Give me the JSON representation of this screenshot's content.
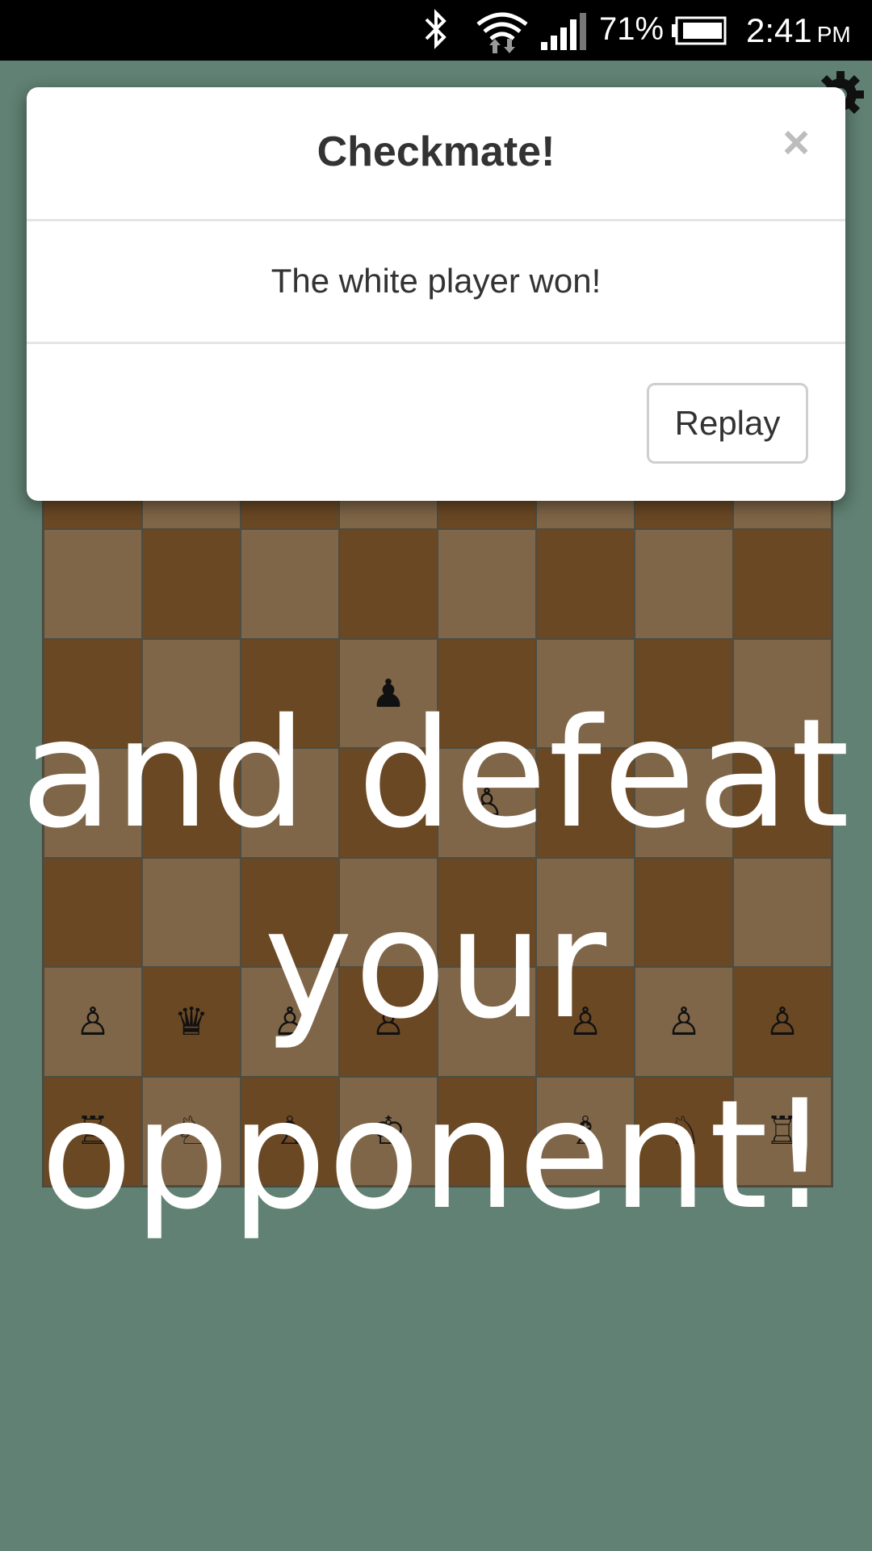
{
  "status_bar": {
    "battery_percent": "71%",
    "time": "2:41",
    "ampm": "PM",
    "icons": [
      "bluetooth-icon",
      "wifi-icon",
      "signal-icon",
      "battery-icon"
    ]
  },
  "settings": {
    "icon": "gear-icon"
  },
  "dialog": {
    "title": "Checkmate!",
    "close_label": "×",
    "message": "The white player won!",
    "replay_label": "Replay"
  },
  "board": {
    "dark_color": "#6b4824",
    "light_color": "#806648",
    "rows": [
      [
        "",
        "",
        "",
        "",
        "",
        "",
        "",
        ""
      ],
      [
        "♟",
        "♟",
        "♟",
        "",
        "♟",
        "♟",
        "♟",
        "♟"
      ],
      [
        "",
        "",
        "",
        "",
        "",
        "",
        "",
        ""
      ],
      [
        "",
        "",
        "",
        "♟",
        "",
        "",
        "",
        ""
      ],
      [
        "",
        "",
        "",
        "",
        "♙",
        "",
        "",
        ""
      ],
      [
        "",
        "",
        "",
        "",
        "",
        "",
        "",
        ""
      ],
      [
        "♙",
        "♛",
        "♙",
        "♙",
        "",
        "♙",
        "♙",
        "♙"
      ],
      [
        "♖",
        "♘",
        "♗",
        "♔",
        "",
        "♗",
        "♘",
        "♖"
      ]
    ]
  },
  "promo": {
    "line1": "and defeat",
    "line2": "your",
    "line3": "opponent!"
  }
}
